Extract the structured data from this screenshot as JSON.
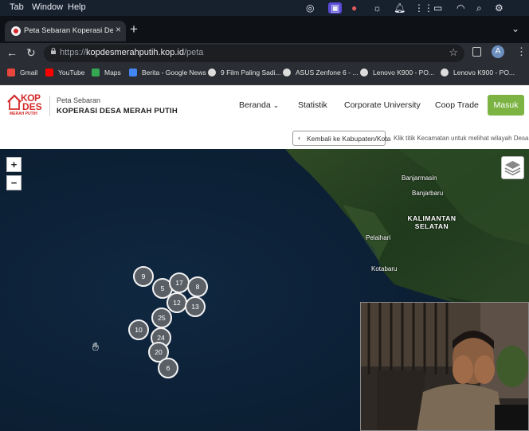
{
  "menubar": {
    "items": [
      "Tab",
      "Window",
      "Help"
    ]
  },
  "tab": {
    "title": "Peta Sebaran Koperasi Desa Merah Putih",
    "close": "×"
  },
  "toolbar": {
    "new_tab": "+",
    "url_scheme": "https://",
    "url_host": "kopdesmerahputih.kop.id",
    "url_path": "/peta",
    "avatar_letter": "A"
  },
  "bookmarks": [
    {
      "label": "Gmail",
      "color": "#e8453c"
    },
    {
      "label": "YouTube",
      "color": "#ff0000"
    },
    {
      "label": "Maps",
      "color": "#34a853"
    },
    {
      "label": "Berita - Google News",
      "color": "#4285f4"
    },
    {
      "label": "9 Film Paling Sadi...",
      "color": "#dddddd"
    },
    {
      "label": "ASUS Zenfone 6 - ...",
      "color": "#dddddd"
    },
    {
      "label": "Lenovo K900 - PO...",
      "color": "#dddddd"
    },
    {
      "label": "Lenovo K900 - PO...",
      "color": "#dddddd"
    }
  ],
  "site": {
    "logo": {
      "kop": "KOP",
      "des": "DES",
      "tagline": "MERAH PUTIH"
    },
    "brand_sub": "Peta Sebaran",
    "brand_main": "KOPERASI DESA MERAH PUTIH",
    "nav": [
      "Beranda",
      "Statistik",
      "Corporate University",
      "Coop Trade"
    ],
    "login": "Masuk",
    "back_button": "Kembali ke Kabupaten/Kota",
    "hint": "Klik titik Kecamatan untuk melihat wilayah Desa"
  },
  "map": {
    "zoom_in": "+",
    "zoom_out": "−",
    "places": [
      "Banjarmasin",
      "Banjarbaru",
      "Pelaihari",
      "Kotabaru"
    ],
    "region_label": [
      "KALIMANTAN",
      "SELATAN"
    ],
    "clusters": [
      "9",
      "5",
      "17",
      "8",
      "12",
      "13",
      "25",
      "10",
      "24",
      "20",
      "6"
    ]
  },
  "colors": {
    "accent_green": "#7cb342",
    "brand_red": "#d42a2a"
  }
}
